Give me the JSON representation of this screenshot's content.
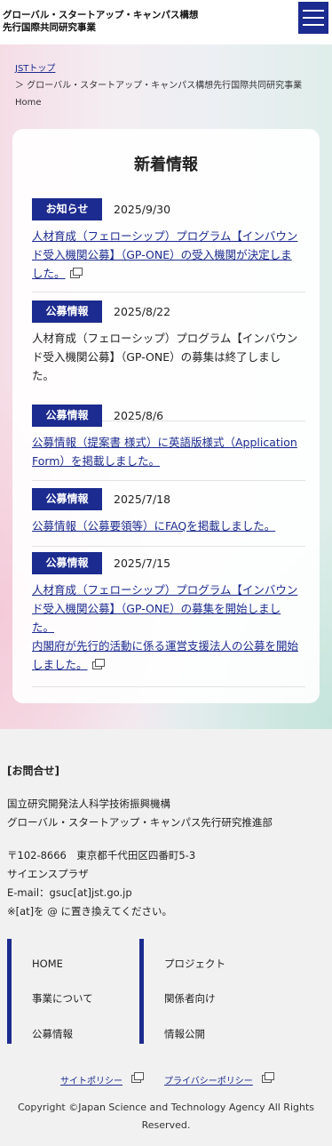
{
  "header": {
    "title_line1": "グローバル・スタートアップ・キャンパス構想",
    "title_line2": "先行国際共同研究事業"
  },
  "breadcrumb": {
    "root": "JSTトップ",
    "current": "＞ グローバル・スタートアップ・キャンパス構想先行国際共同研究事業 Home"
  },
  "news": {
    "title": "新着情報",
    "items": [
      {
        "badge": "お知らせ",
        "date": "2025/9/30",
        "text": "人材育成（フェローシップ）プログラム【インバウンド受入機関公募】（GP-ONE）の受入機関が決定しました。"
      },
      {
        "badge": "公募情報",
        "date": "2025/8/22",
        "text": "人材育成（フェローシップ）プログラム【インバウンド受入機関公募】（GP-ONE）の募集は終了しました。"
      },
      {
        "badge": "公募情報",
        "date": "2025/8/6",
        "text": "公募情報（提案書 様式）に英語版様式（Application Form）を掲載しました。"
      },
      {
        "badge": "公募情報",
        "date": "2025/7/18",
        "text": "公募情報（公募要領等）にFAQを掲載しました。"
      },
      {
        "badge": "公募情報",
        "date": "2025/7/15",
        "text": "人材育成（フェローシップ）プログラム【インバウンド受入機関公募】（GP-ONE）の募集を開始しました。",
        "text2": "内閣府が先行的活動に係る運営支援法人の公募を開始しました。"
      }
    ]
  },
  "footer": {
    "heading": "[お問合せ]",
    "org_line1": "国立研究開発法人科学技術振興機構",
    "org_line2": "グローバル・スタートアップ・キャンパス先行研究推進部",
    "postal": "〒102-8666　東京都千代田区四番町5-3",
    "building": "サイエンスプラザ",
    "email": "E-mail：gsuc[at]jst.go.jp",
    "note": "※[at]を @ に置き換えてください。",
    "nav": [
      "HOME",
      "事業について",
      "公募情報",
      "プロジェクト",
      "関係者向け",
      "情報公開"
    ],
    "site_policy": "サイトポリシー",
    "privacy_policy": "プライバシーポリシー",
    "copyright": "Copyright ©Japan Science and Technology Agency All Rights Reserved."
  },
  "colors": {
    "accent": "#1c2b8f"
  }
}
